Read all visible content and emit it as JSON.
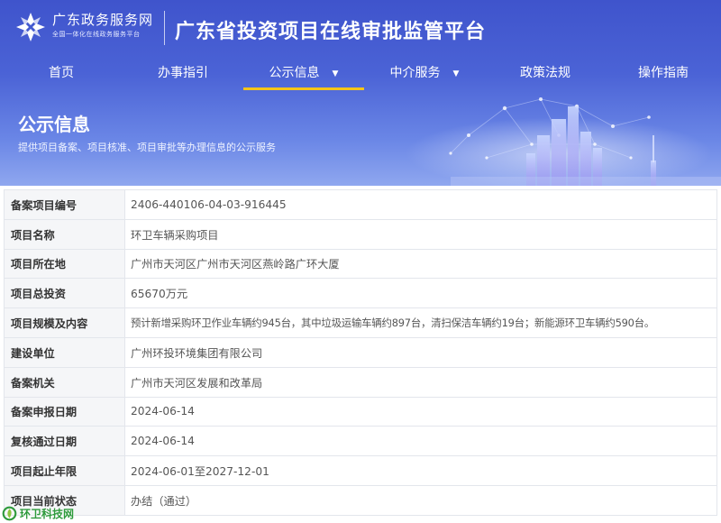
{
  "header": {
    "logo_name": "广东政务服务网",
    "logo_slogan": "全国一体化在线政务服务平台",
    "platform_title": "广东省投资项目在线审批监管平台"
  },
  "nav": {
    "items": [
      {
        "label": "首页"
      },
      {
        "label": "办事指引"
      },
      {
        "label": "公示信息",
        "active": true,
        "has_dropdown": true
      },
      {
        "label": "中介服务",
        "has_dropdown": true
      },
      {
        "label": "政策法规"
      },
      {
        "label": "操作指南"
      }
    ],
    "active_color": "#f5c518"
  },
  "section": {
    "title": "公示信息",
    "subtitle": "提供项目备案、项目核准、项目审批等办理信息的公示服务"
  },
  "record": {
    "rows": [
      {
        "label": "备案项目编号",
        "value": "2406-440106-04-03-916445"
      },
      {
        "label": "项目名称",
        "value": "环卫车辆采购项目"
      },
      {
        "label": "项目所在地",
        "value": "广州市天河区广州市天河区燕岭路广环大厦"
      },
      {
        "label": "项目总投资",
        "value": "65670万元"
      },
      {
        "label": "项目规模及内容",
        "value": "预计新增采购环卫作业车辆约945台，其中垃圾运输车辆约897台，清扫保洁车辆约19台；新能源环卫车辆约590台。"
      },
      {
        "label": "建设单位",
        "value": "广州环投环境集团有限公司"
      },
      {
        "label": "备案机关",
        "value": "广州市天河区发展和改革局"
      },
      {
        "label": "备案申报日期",
        "value": "2024-06-14"
      },
      {
        "label": "复核通过日期",
        "value": "2024-06-14"
      },
      {
        "label": "项目起止年限",
        "value": "2024-06-01至2027-12-01"
      },
      {
        "label": "项目当前状态",
        "value": "办结（通过）"
      }
    ]
  },
  "watermark": {
    "text": "环卫科技网"
  },
  "colors": {
    "banner_top": "#3f54cc",
    "banner_bottom": "#8fa7ef",
    "label_bg": "#f5f6f8",
    "border": "#e3e6ec",
    "watermark_green": "#2e9a3c"
  }
}
